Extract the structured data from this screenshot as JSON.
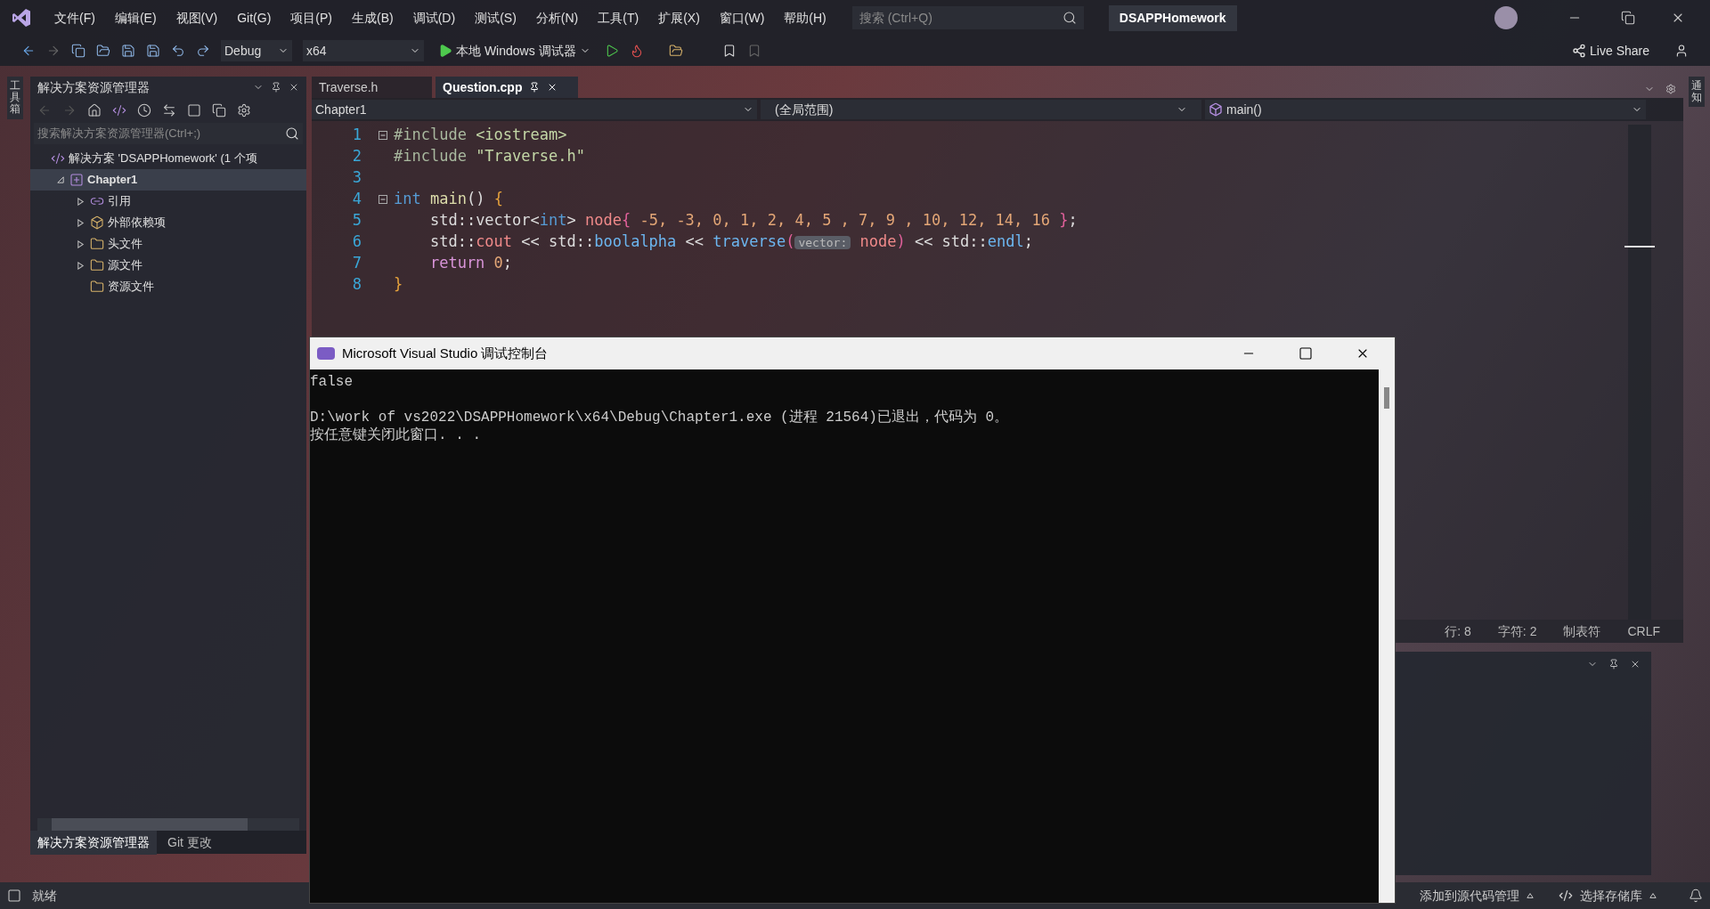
{
  "menu_bar": {
    "items": [
      "文件(F)",
      "编辑(E)",
      "视图(V)",
      "Git(G)",
      "项目(P)",
      "生成(B)",
      "调试(D)",
      "测试(S)",
      "分析(N)",
      "工具(T)",
      "扩展(X)",
      "窗口(W)",
      "帮助(H)"
    ],
    "search": {
      "placeholder": "搜索 (Ctrl+Q)"
    },
    "solution_name": "DSAPPHomework"
  },
  "toolbar": {
    "configuration": "Debug",
    "platform": "x64",
    "run_label": "本地 Windows 调试器",
    "live_share": "Live Share"
  },
  "toolbox_strip": {
    "label": "工具箱"
  },
  "solution_explorer": {
    "title": "解决方案资源管理器",
    "search": {
      "placeholder": "搜索解决方案资源管理器(Ctrl+;)"
    },
    "tree": [
      {
        "label": "解决方案 'DSAPPHomework' (1 个项",
        "kind": "solution",
        "selected": false,
        "expanded": true,
        "children": [
          {
            "label": "Chapter1",
            "kind": "project",
            "selected": true,
            "expanded": true,
            "children": [
              {
                "label": "引用",
                "kind": "references",
                "selected": false,
                "expanded": false
              },
              {
                "label": "外部依赖项",
                "kind": "external",
                "selected": false,
                "expanded": false
              },
              {
                "label": "头文件",
                "kind": "filter",
                "selected": false,
                "expanded": false
              },
              {
                "label": "源文件",
                "kind": "filter",
                "selected": false,
                "expanded": false
              },
              {
                "label": "资源文件",
                "kind": "filter",
                "selected": false,
                "empty": true
              }
            ]
          }
        ]
      }
    ],
    "bottom_tabs": [
      {
        "label": "解决方案资源管理器",
        "selected": true
      },
      {
        "label": "Git 更改",
        "selected": false
      }
    ]
  },
  "editor": {
    "tabs": [
      {
        "label": "Traverse.h",
        "selected": false
      },
      {
        "label": "Question.cpp",
        "selected": true
      }
    ],
    "nav_bar": {
      "project": "Chapter1",
      "scope": "(全局范围)",
      "member": "main()"
    },
    "lines": [
      {
        "number": "1",
        "fold": true,
        "tokens": [
          {
            "text": "#include",
            "kind": "pre"
          },
          {
            "text": " <iostream>",
            "kind": "str"
          }
        ]
      },
      {
        "number": "2",
        "fold": false,
        "tokens": [
          {
            "text": "#include",
            "kind": "pre"
          },
          {
            "text": " \"Traverse.h\"",
            "kind": "str"
          }
        ]
      },
      {
        "number": "3",
        "fold": false
      },
      {
        "number": "4",
        "fold": true,
        "tokens": [
          {
            "text": "int ",
            "kind": "kw"
          },
          {
            "text": "main",
            "kind": "fn"
          },
          {
            "text": "() ",
            "kind": "plain"
          },
          {
            "text": "{",
            "kind": "brace"
          }
        ]
      },
      {
        "number": "5",
        "fold": false,
        "tokens": [
          {
            "text": "    std::",
            "kind": "plain"
          },
          {
            "text": "vector",
            "kind": "plain"
          },
          {
            "text": "<",
            "kind": "plain"
          },
          {
            "text": "int",
            "kind": "kw"
          },
          {
            "text": "> ",
            "kind": "plain"
          },
          {
            "text": "node",
            "kind": "var"
          },
          {
            "text": "{ ",
            "kind": "brace2"
          },
          {
            "text": "-5, -3, 0, 1, 2, 4, 5 , 7, 9 , 10, 12, 14, 16 ",
            "kind": "num"
          },
          {
            "text": "}",
            "kind": "brace2"
          },
          {
            "text": ";",
            "kind": "plain"
          }
        ]
      },
      {
        "number": "6",
        "fold": false,
        "tokens": [
          {
            "text": "    std::",
            "kind": "plain"
          },
          {
            "text": "cout",
            "kind": "var"
          },
          {
            "text": " << std::",
            "kind": "plain"
          },
          {
            "text": "boolalpha",
            "kind": "blue"
          },
          {
            "text": " << ",
            "kind": "plain"
          },
          {
            "text": "traverse",
            "kind": "blue"
          },
          {
            "text": "(",
            "kind": "brace2"
          },
          {
            "text": "vector:",
            "kind": "hint"
          },
          {
            "text": " node",
            "kind": "var"
          },
          {
            "text": ")",
            "kind": "brace2"
          },
          {
            "text": " << std::",
            "kind": "plain"
          },
          {
            "text": "endl",
            "kind": "blue"
          },
          {
            "text": ";",
            "kind": "plain"
          }
        ]
      },
      {
        "number": "7",
        "fold": false,
        "tokens": [
          {
            "text": "    return ",
            "kind": "ctrl"
          },
          {
            "text": "0",
            "kind": "num"
          },
          {
            "text": ";",
            "kind": "plain"
          }
        ]
      },
      {
        "number": "8",
        "fold": false,
        "tokens": [
          {
            "text": "}",
            "kind": "brace"
          }
        ]
      }
    ],
    "status": [
      "行: 8",
      "字符: 2",
      "制表符",
      "CRLF"
    ]
  },
  "notifications_strip": {
    "label": "通知"
  },
  "console": {
    "title": "Microsoft Visual Studio 调试控制台",
    "paragraphs": [
      [
        "false"
      ],
      [
        "D:\\work of vs2022\\DSAPPHomework\\x64\\Debug\\Chapter1.exe (进程 21564)已退出，代码为 0。",
        "按任意键关闭此窗口. . ."
      ]
    ]
  },
  "status_bar": {
    "state": "就绪",
    "source_control": "添加到源代码管理",
    "repository": "选择存储库"
  }
}
